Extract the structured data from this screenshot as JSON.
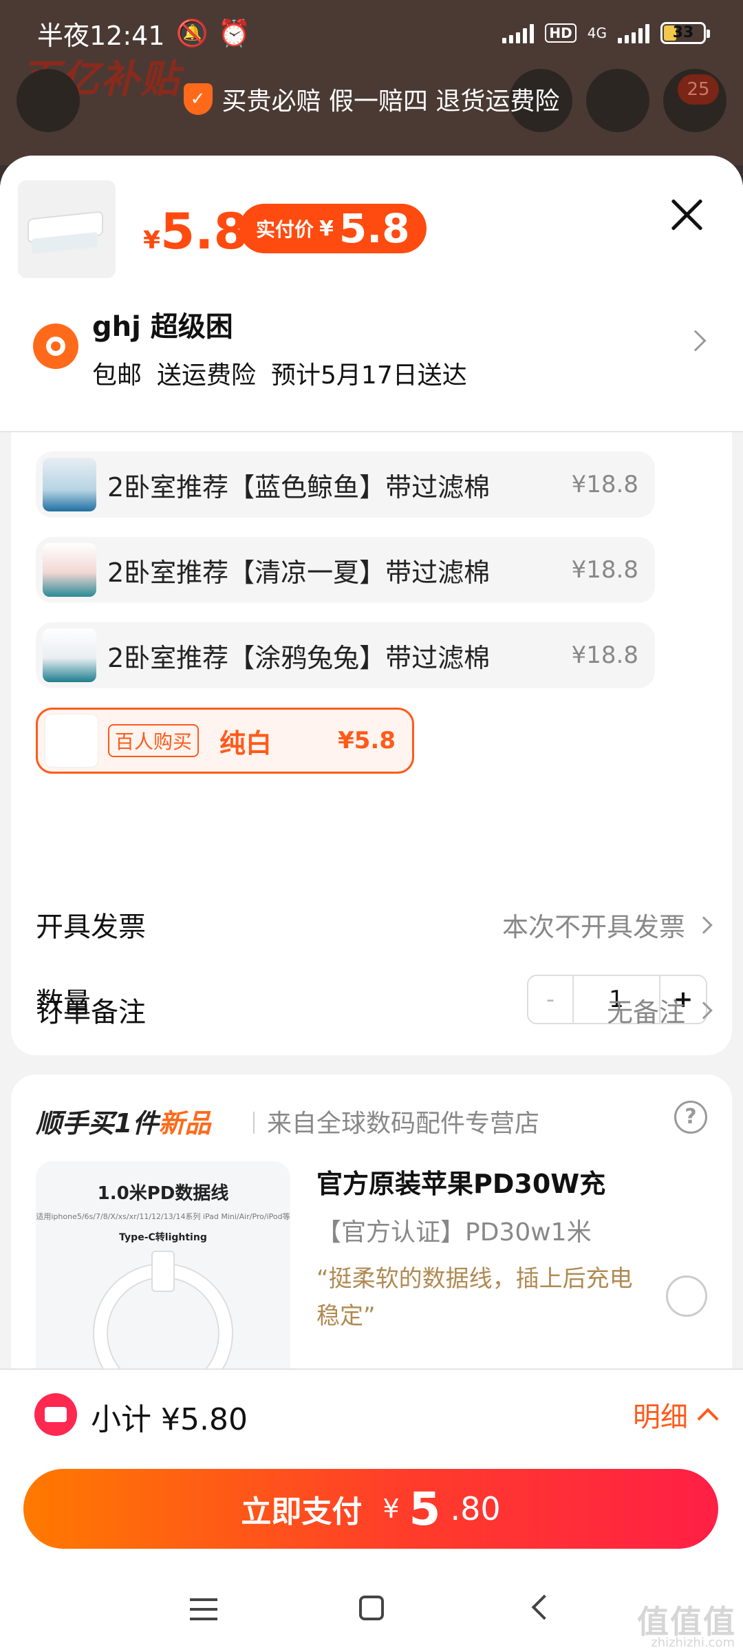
{
  "status_bar": {
    "time": "半夜12:41",
    "network": "4G",
    "hd": "HD",
    "battery": "33"
  },
  "background": {
    "banner_text": "百亿补贴",
    "cart_badge": "25"
  },
  "guarantee": {
    "text": "买贵必赔 假一赔四 退货运费险"
  },
  "product": {
    "currency": "¥",
    "price": "5.8",
    "pay_label": "实付价",
    "pay_price": "5.8"
  },
  "address": {
    "name": "ghj 超级困",
    "shipping": [
      "包邮",
      "送运费险",
      "预计5月17日送达"
    ]
  },
  "skus": [
    {
      "name": "2卧室推荐【蓝色鲸鱼】带过滤棉",
      "price": "¥18.8"
    },
    {
      "name": "2卧室推荐【清凉一夏】带过滤棉",
      "price": "¥18.8"
    },
    {
      "name": "2卧室推荐【涂鸦兔兔】带过滤棉",
      "price": "¥18.8"
    },
    {
      "tag": "百人购买",
      "name": "纯白",
      "price": "¥5.8",
      "selected": true
    }
  ],
  "quantity": {
    "label": "数量",
    "minus": "-",
    "value": "1",
    "plus": "+"
  },
  "invoice": {
    "label": "开具发票",
    "value": "本次不开具发票"
  },
  "remark": {
    "label": "订单备注",
    "value": "无备注"
  },
  "addon": {
    "title_prefix": "顺手买1件",
    "title_new": "新品",
    "store": "来自全球数码配件专营店",
    "help": "?",
    "image_title": "1.0米PD数据线",
    "image_sub": "适用iphone5/6s/7/8/X/xs/xr/11/12/13/14系列 iPad Mini/Air/Pro/iPod等",
    "image_type": "Type-C转lighting",
    "name": "官方原装苹果PD30W充",
    "spec": "【官方认证】PD30w1米",
    "quote": "“挺柔软的数据线，插上后充电稳定”"
  },
  "bottom": {
    "subtotal_label": "小计",
    "subtotal": "¥5.80",
    "detail": "明细",
    "pay_label": "立即支付",
    "pay_currency": "¥",
    "pay_int": "5",
    "pay_dec": ".80"
  },
  "watermark": {
    "text": "值值值",
    "site": "zhizhizhi.com"
  },
  "colors": {
    "accent": "#ff4b0f",
    "accent_red": "#ff1f45",
    "quote": "#b08a52"
  }
}
